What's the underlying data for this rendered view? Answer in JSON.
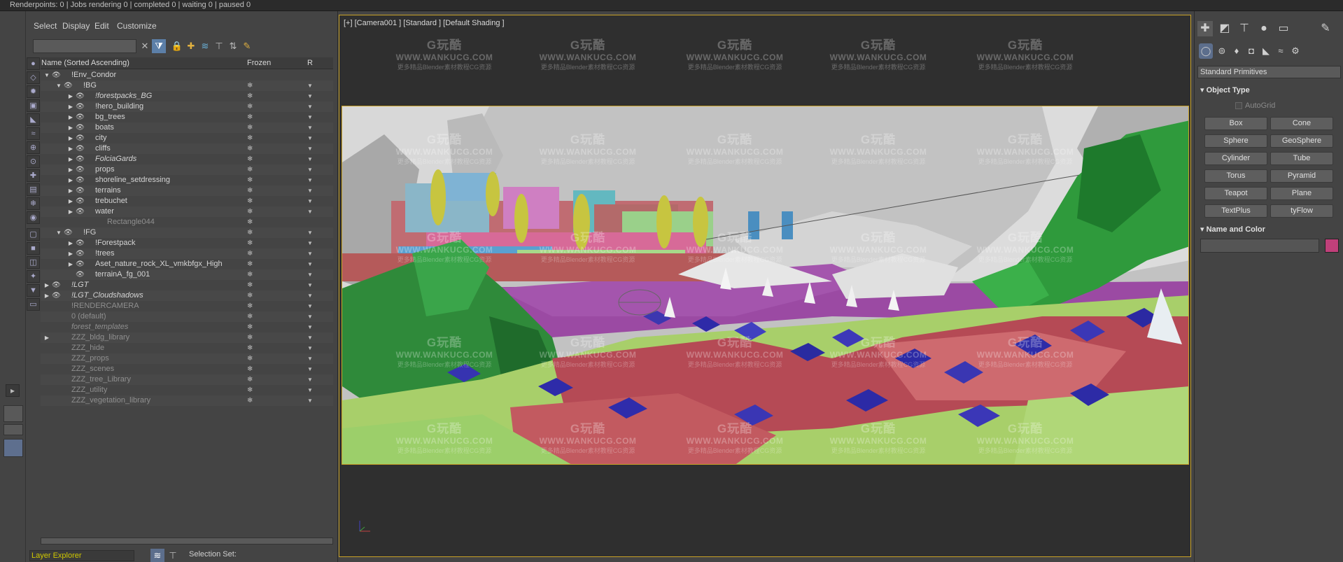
{
  "status": {
    "text": "Renderpoints: 0 | Jobs rendering 0 | completed 0 | waiting 0 | paused 0"
  },
  "explorer": {
    "menu": [
      "Select",
      "Display",
      "Edit",
      "Customize"
    ],
    "search": {
      "value": "",
      "placeholder": ""
    },
    "columns": {
      "name": "Name (Sorted Ascending)",
      "frozen": "Frozen",
      "r": "R"
    },
    "rows": [
      {
        "indent": 0,
        "arrow": "▼",
        "eye": "👁",
        "label": "!Env_Condor",
        "style": "normal",
        "freeze": "",
        "r": ""
      },
      {
        "indent": 1,
        "arrow": "▼",
        "eye": "👁",
        "label": "!BG",
        "style": "normal",
        "freeze": "❄",
        "r": "▼"
      },
      {
        "indent": 2,
        "arrow": "▶",
        "eye": "👁",
        "label": "!forestpacks_BG",
        "style": "italic",
        "freeze": "❄",
        "r": "▼"
      },
      {
        "indent": 2,
        "arrow": "▶",
        "eye": "👁",
        "label": "!hero_building",
        "style": "normal",
        "freeze": "❄",
        "r": "▼"
      },
      {
        "indent": 2,
        "arrow": "▶",
        "eye": "👁",
        "label": "bg_trees",
        "style": "normal",
        "freeze": "❄",
        "r": "▼"
      },
      {
        "indent": 2,
        "arrow": "▶",
        "eye": "👁",
        "label": "boats",
        "style": "normal",
        "freeze": "❄",
        "r": "▼"
      },
      {
        "indent": 2,
        "arrow": "▶",
        "eye": "👁",
        "label": "city",
        "style": "normal",
        "freeze": "❄",
        "r": "▼"
      },
      {
        "indent": 2,
        "arrow": "▶",
        "eye": "👁",
        "label": "cliffs",
        "style": "normal",
        "freeze": "❄",
        "r": "▼"
      },
      {
        "indent": 2,
        "arrow": "▶",
        "eye": "👁",
        "label": "FolciaGards",
        "style": "italic",
        "freeze": "❄",
        "r": "▼"
      },
      {
        "indent": 2,
        "arrow": "▶",
        "eye": "👁",
        "label": "props",
        "style": "normal",
        "freeze": "❄",
        "r": "▼"
      },
      {
        "indent": 2,
        "arrow": "▶",
        "eye": "👁",
        "label": "shoreline_setdressing",
        "style": "normal",
        "freeze": "❄",
        "r": "▼"
      },
      {
        "indent": 2,
        "arrow": "▶",
        "eye": "👁",
        "label": "terrains",
        "style": "normal",
        "freeze": "❄",
        "r": "▼"
      },
      {
        "indent": 2,
        "arrow": "▶",
        "eye": "👁",
        "label": "trebuchet",
        "style": "normal",
        "freeze": "❄",
        "r": "▼"
      },
      {
        "indent": 2,
        "arrow": "▶",
        "eye": "👁",
        "label": "water",
        "style": "normal",
        "freeze": "❄",
        "r": "▼"
      },
      {
        "indent": 3,
        "arrow": "",
        "eye": "",
        "label": "Rectangle044",
        "style": "dim",
        "freeze": "❄",
        "r": ""
      },
      {
        "indent": 1,
        "arrow": "▼",
        "eye": "👁",
        "label": "!FG",
        "style": "normal",
        "freeze": "❄",
        "r": "▼"
      },
      {
        "indent": 2,
        "arrow": "▶",
        "eye": "👁",
        "label": "!Forestpack",
        "style": "normal",
        "freeze": "❄",
        "r": "▼"
      },
      {
        "indent": 2,
        "arrow": "▶",
        "eye": "👁",
        "label": "!trees",
        "style": "normal",
        "freeze": "❄",
        "r": "▼"
      },
      {
        "indent": 2,
        "arrow": "▶",
        "eye": "👁",
        "label": "Aset_nature_rock_XL_vmkbfgx_High",
        "style": "normal",
        "freeze": "❄",
        "r": "▼"
      },
      {
        "indent": 2,
        "arrow": "",
        "eye": "👁",
        "label": "terrainA_fg_001",
        "style": "normal",
        "freeze": "❄",
        "r": "▼"
      },
      {
        "indent": 0,
        "arrow": "▶",
        "eye": "👁",
        "label": "!LGT",
        "style": "italic",
        "freeze": "❄",
        "r": "▼"
      },
      {
        "indent": 0,
        "arrow": "▶",
        "eye": "👁",
        "label": "!LGT_Cloudshadows",
        "style": "italic",
        "freeze": "❄",
        "r": "▼"
      },
      {
        "indent": 0,
        "arrow": "",
        "eye": "",
        "label": "!RENDERCAMERA",
        "style": "dim",
        "freeze": "❄",
        "r": "▼"
      },
      {
        "indent": 0,
        "arrow": "",
        "eye": "",
        "label": "0 (default)",
        "style": "dim",
        "freeze": "❄",
        "r": "▼"
      },
      {
        "indent": 0,
        "arrow": "",
        "eye": "",
        "label": "forest_templates",
        "style": "dimitalic",
        "freeze": "❄",
        "r": "▼"
      },
      {
        "indent": 0,
        "arrow": "▶",
        "eye": "",
        "label": "ZZZ_bldg_library",
        "style": "dim",
        "freeze": "❄",
        "r": "▼"
      },
      {
        "indent": 0,
        "arrow": "",
        "eye": "",
        "label": "ZZZ_hide",
        "style": "dim",
        "freeze": "❄",
        "r": "▼"
      },
      {
        "indent": 0,
        "arrow": "",
        "eye": "",
        "label": "ZZZ_props",
        "style": "dim",
        "freeze": "❄",
        "r": "▼"
      },
      {
        "indent": 0,
        "arrow": "",
        "eye": "",
        "label": "ZZZ_scenes",
        "style": "dim",
        "freeze": "❄",
        "r": "▼"
      },
      {
        "indent": 0,
        "arrow": "",
        "eye": "",
        "label": "ZZZ_tree_Library",
        "style": "dim",
        "freeze": "❄",
        "r": "▼"
      },
      {
        "indent": 0,
        "arrow": "",
        "eye": "",
        "label": "ZZZ_utility",
        "style": "dim",
        "freeze": "❄",
        "r": "▼"
      },
      {
        "indent": 0,
        "arrow": "",
        "eye": "",
        "label": "ZZZ_vegetation_library",
        "style": "dim",
        "freeze": "❄",
        "r": "▼"
      }
    ],
    "bottom": {
      "layer_explorer": "Layer Explorer",
      "selection_set": "Selection Set:"
    }
  },
  "viewport": {
    "label": "[+] [Camera001 ] [Standard ] [Default Shading ]"
  },
  "command_panel": {
    "dropdown": "Standard Primitives",
    "object_type_title": "Object Type",
    "autogrid": "AutoGrid",
    "primitives": [
      "Box",
      "Cone",
      "Sphere",
      "GeoSphere",
      "Cylinder",
      "Tube",
      "Torus",
      "Pyramid",
      "Teapot",
      "Plane",
      "TextPlus",
      "tyFlow"
    ],
    "name_color_title": "Name and Color",
    "swatch_color": "#c0407a"
  },
  "watermark": {
    "logo": "G玩酷",
    "url": "WWW.WANKUCG.COM",
    "tag": "更多精品Blender素材教程CG资源"
  },
  "colors": {
    "accent": "#c9a227",
    "panel": "#444444"
  }
}
